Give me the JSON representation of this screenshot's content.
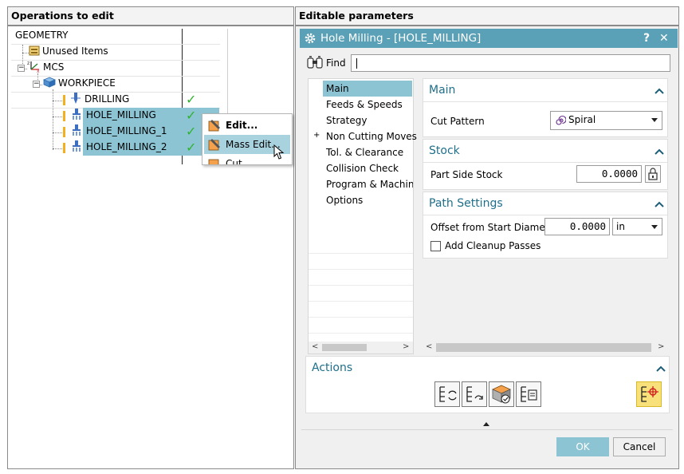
{
  "left_pane": {
    "header": "Operations to edit",
    "tree": [
      {
        "label": "GEOMETRY"
      },
      {
        "label": "Unused Items"
      },
      {
        "label": "MCS"
      },
      {
        "label": "WORKPIECE"
      },
      {
        "label": "DRILLING"
      },
      {
        "label": "HOLE_MILLING"
      },
      {
        "label": "HOLE_MILLING_1"
      },
      {
        "label": "HOLE_MILLING_2"
      }
    ],
    "context_menu": [
      {
        "label": "Edit..."
      },
      {
        "label": "Mass Edit..."
      },
      {
        "label": "Cut"
      }
    ]
  },
  "right_pane": {
    "header": "Editable parameters",
    "dialog": {
      "title": "Hole Milling - [HOLE_MILLING]",
      "help": "?",
      "close": "✕",
      "find_label": "Find",
      "find_value": "",
      "nav": [
        "Main",
        "Feeds & Speeds",
        "Strategy",
        "Non Cutting Moves",
        "Tol. & Clearance",
        "Collision Check",
        "Program & Machine",
        "Options"
      ],
      "nav_expander": "+",
      "main_panel": {
        "title": "Main",
        "cut_pattern_label": "Cut Pattern",
        "cut_pattern_value": "Spiral"
      },
      "stock_panel": {
        "title": "Stock",
        "part_side_stock_label": "Part Side Stock",
        "part_side_stock_value": "0.0000"
      },
      "path_panel": {
        "title": "Path Settings",
        "offset_label": "Offset from Start Diameter",
        "offset_value": "0.0000",
        "offset_unit": "in",
        "cleanup_label": "Add Cleanup Passes",
        "cleanup_checked": false
      },
      "actions": {
        "title": "Actions"
      },
      "ok": "OK",
      "cancel": "Cancel"
    }
  },
  "colors": {
    "accent": "#5aa0b6",
    "selection": "#8cc4d4",
    "panel_title": "#1e6f8a",
    "check": "#2fb42f",
    "warning": "#f2b01e",
    "highlight_action": "#f8e07a"
  },
  "icons": [
    "geometry-group-icon",
    "mcs-axis-icon",
    "workpiece-icon",
    "drill-tool-icon",
    "hole-mill-tool-icon",
    "check-icon",
    "edit-icon",
    "mass-edit-icon",
    "cut-icon",
    "gear-icon",
    "binoculars-icon",
    "spiral-icon",
    "lock-icon",
    "caret-up-icon",
    "regenerate-icon",
    "generate-icon",
    "verify-icon",
    "list-icon",
    "path-display-icon"
  ]
}
